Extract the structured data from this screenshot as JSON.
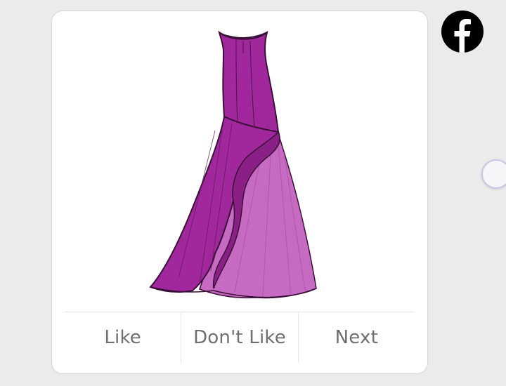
{
  "card": {
    "image_alt": "Purple sleeveless gown illustration",
    "actions": [
      {
        "label": "Like"
      },
      {
        "label": "Don't Like"
      },
      {
        "label": "Next"
      }
    ]
  },
  "icons": {
    "social": "facebook-icon",
    "side": "floating-circle-handle"
  },
  "colors": {
    "dress_main": "#a0289c",
    "dress_light": "#c76bc2",
    "dress_outline": "#3a1038",
    "background": "#ebebeb",
    "card": "#ffffff",
    "button_text": "#6f6f6f"
  }
}
